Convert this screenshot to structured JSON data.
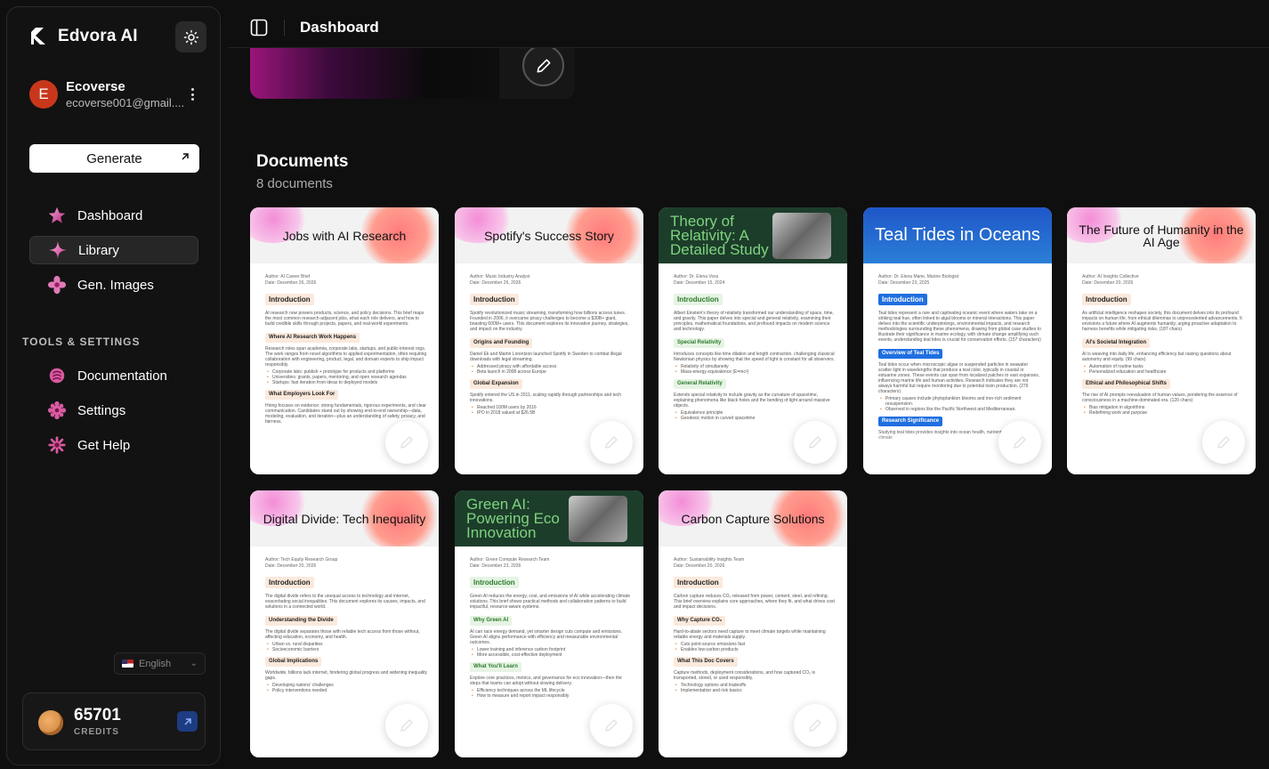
{
  "app": {
    "name": "Edvora AI"
  },
  "user": {
    "initial": "E",
    "name": "Ecoverse",
    "email": "ecoverse001@gmail...."
  },
  "sidebar": {
    "generate_label": "Generate",
    "items": [
      {
        "label": "Dashboard",
        "icon": "star-gem-icon"
      },
      {
        "label": "Library",
        "icon": "sparkle-icon",
        "active": true
      },
      {
        "label": "Gen. Images",
        "icon": "flower-icon"
      }
    ],
    "tools_title": "TOOLS & SETTINGS",
    "tools": [
      {
        "label": "Documentation",
        "icon": "documentation-icon"
      },
      {
        "label": "Settings",
        "icon": "settings-icon"
      },
      {
        "label": "Get Help",
        "icon": "help-icon"
      }
    ],
    "language": "English",
    "credits_value": "65701",
    "credits_label": "CREDITS"
  },
  "header": {
    "title": "Dashboard"
  },
  "documents": {
    "title": "Documents",
    "count": "8 documents",
    "cards": [
      {
        "title": "Jobs with AI Research",
        "style": "gradient",
        "author": "Author: AI Career Brief",
        "date": "Date: December 26, 2026",
        "sections": [
          {
            "heading": "Introduction",
            "size": "lg",
            "lines": [
              "AI research now powers products, science, and policy decisions. This brief maps the most common research-adjacent jobs, what each role delivers, and how to build credible skills through projects, papers, and real-world experiments."
            ]
          },
          {
            "heading": "Where AI Research Work Happens",
            "size": "sm",
            "lines": [
              "Research roles span academia, corporate labs, startups, and public-interest orgs. The work ranges from novel algorithms to applied experimentation, often requiring collaboration with engineering, product, legal, and domain experts to ship impact responsibly."
            ],
            "bullets": [
              "Corporate labs: publish + prototype for products and platforms",
              "Universities: grants, papers, mentoring, and open research agendas",
              "Startups: fast iteration from ideas to deployed models"
            ]
          },
          {
            "heading": "What Employers Look For",
            "size": "sm",
            "lines": [
              "Hiring focuses on evidence: strong fundamentals, rigorous experiments, and clear communication. Candidates stand out by showing end-to-end ownership—data, modeling, evaluation, and iteration—plus an understanding of safety, privacy, and fairness."
            ]
          }
        ]
      },
      {
        "title": "Spotify's Success Story",
        "style": "gradient",
        "author": "Author: Music Industry Analyst",
        "date": "Date: December 26, 2026",
        "sections": [
          {
            "heading": "Introduction",
            "size": "lg",
            "lines": [
              "Spotify revolutionized music streaming, transforming how billions access tunes. Founded in 2006, it overcame piracy challenges to become a $30B+ giant, boasting 600M+ users. This document explores its innovative journey, strategies, and impact on the industry."
            ]
          },
          {
            "heading": "Origins and Founding",
            "size": "sm",
            "lines": [
              "Daniel Ek and Martin Lorentzon launched Spotify in Sweden to combat illegal downloads with legal streaming."
            ],
            "bullets": [
              "Addressed piracy with affordable access",
              "Beta launch in 2008 across Europe"
            ]
          },
          {
            "heading": "Global Expansion",
            "size": "sm",
            "lines": [
              "Spotify entered the US in 2011, scaling rapidly through partnerships and tech innovations."
            ],
            "bullets": [
              "Reached 100M users by 2016",
              "IPO in 2018 valued at $26.5B"
            ]
          }
        ]
      },
      {
        "title": "Theory of Relativity: A Detailed Study",
        "style": "green",
        "author": "Author: Dr. Elena Voss",
        "date": "Date: December 15, 2024",
        "sections": [
          {
            "heading": "Introduction",
            "size": "lg",
            "accent": "green",
            "lines": [
              "Albert Einstein's theory of relativity transformed our understanding of space, time, and gravity. This paper delves into special and general relativity, examining their principles, mathematical foundations, and profound impacts on modern science and technology."
            ]
          },
          {
            "heading": "Special Relativity",
            "size": "sm",
            "accent": "green",
            "lines": [
              "Introduces concepts like time dilation and length contraction, challenging classical Newtonian physics by showing that the speed of light is constant for all observers."
            ],
            "bullets": [
              "Relativity of simultaneity",
              "Mass-energy equivalence (E=mc²)"
            ]
          },
          {
            "heading": "General Relativity",
            "size": "sm",
            "accent": "green",
            "lines": [
              "Extends special relativity to include gravity as the curvature of spacetime, explaining phenomena like black holes and the bending of light around massive objects."
            ],
            "bullets": [
              "Equivalence principle",
              "Geodesic motion in curved spacetime"
            ]
          }
        ]
      },
      {
        "title": "Teal Tides in Oceans",
        "style": "blue",
        "author": "Author: Dr. Elena Marie, Marine Biologist",
        "date": "Date: December 23, 2025",
        "sections": [
          {
            "heading": "Introduction",
            "size": "lg",
            "accent": "blue",
            "lines": [
              "Teal tides represent a rare and captivating oceanic event where waters take on a striking teal hue, often linked to algal blooms or mineral interactions. This paper delves into the scientific underpinnings, environmental impacts, and research methodologies surrounding these phenomena, drawing from global case studies to illustrate their significance in marine ecology, with climate change amplifying such events, understanding teal tides is crucial for conservation efforts. (157 characters)"
            ]
          },
          {
            "heading": "Overview of Teal Tides",
            "size": "sm",
            "accent": "blue",
            "lines": [
              "Teal tides occur when microscopic algae or suspended particles in seawater scatter light in wavelengths that produce a teal color, typically in coastal or estuarine zones. These events can span from localized patches to vast expanses, influencing marine life and human activities. Research indicates they are not always harmful but require monitoring due to potential toxin production. (279 characters)"
            ],
            "bullets": [
              "Primary causes include phytoplankton blooms and iron-rich sediment resuspension.",
              "Observed in regions like the Pacific Northwest and Mediterranean."
            ]
          },
          {
            "heading": "Research Significance",
            "size": "sm",
            "accent": "blue",
            "lines": [
              "Studying teal tides provides insights into ocean health, nutrient cycling, and climate"
            ]
          }
        ]
      },
      {
        "title": "The Future of Humanity in the AI Age",
        "style": "gradient",
        "author": "Author: AI Insights Collective",
        "date": "Date: December 20, 2026",
        "sections": [
          {
            "heading": "Introduction",
            "size": "lg",
            "lines": [
              "As artificial intelligence reshapes society, this document delves into its profound impacts on human life, from ethical dilemmas to unprecedented advancements. It envisions a future where AI augments humanity, urging proactive adaptation to harness benefits while mitigating risks. (187 chars)"
            ]
          },
          {
            "heading": "AI's Societal Integration",
            "size": "sm",
            "lines": [
              "AI is weaving into daily life, enhancing efficiency but raising questions about autonomy and equity. (99 chars)"
            ],
            "bullets": [
              "Automation of routine tasks",
              "Personalized education and healthcare"
            ]
          },
          {
            "heading": "Ethical and Philosophical Shifts",
            "size": "sm",
            "lines": [
              "The rise of AI prompts reevaluation of human values, pondering the essence of consciousness in a machine-dominated era. (120 chars)"
            ],
            "bullets": [
              "Bias mitigation in algorithms",
              "Redefining work and purpose"
            ]
          }
        ]
      },
      {
        "title": "Digital Divide: Tech Inequality",
        "style": "gradient",
        "author": "Author: Tech Equity Research Group",
        "date": "Date: December 20, 2026",
        "sections": [
          {
            "heading": "Introduction",
            "size": "lg",
            "lines": [
              "The digital divide refers to the unequal access to technology and internet, exacerbating social inequalities. This document explores its causes, impacts, and solutions in a connected world."
            ]
          },
          {
            "heading": "Understanding the Divide",
            "size": "sm",
            "lines": [
              "The digital divide separates those with reliable tech access from those without, affecting education, economy, and health."
            ],
            "bullets": [
              "Urban vs. rural disparities",
              "Socioeconomic barriers"
            ]
          },
          {
            "heading": "Global Implications",
            "size": "sm",
            "lines": [
              "Worldwide, billions lack internet, hindering global progress and widening inequality gaps."
            ],
            "bullets": [
              "Developing nations' challenges",
              "Policy interventions needed"
            ]
          }
        ]
      },
      {
        "title": "Green AI: Powering Eco Innovation",
        "style": "green",
        "author": "Author: Green Compute Research Team",
        "date": "Date: December 23, 2026",
        "sections": [
          {
            "heading": "Introduction",
            "size": "lg",
            "accent": "green",
            "lines": [
              "Green AI reduces the energy, cost, and emissions of AI while accelerating climate solutions. This brief shows practical methods and collaboration patterns to build impactful, resource-aware systems."
            ]
          },
          {
            "heading": "Why Green AI",
            "size": "sm",
            "accent": "green",
            "lines": [
              "AI can race energy demand, yet smarter design cuts compute and emissions. Green AI aligns performance with efficiency and measurable environmental outcomes."
            ],
            "bullets": [
              "Lower training and inference carbon footprint",
              "More accessible, cost-effective deployment"
            ]
          },
          {
            "heading": "What You'll Learn",
            "size": "sm",
            "accent": "green",
            "lines": [
              "Explore core practices, metrics, and governance for eco innovation—then the steps that teams can adopt without slowing delivery."
            ],
            "bullets": [
              "Efficiency techniques across the ML lifecycle",
              "How to measure and report impact responsibly"
            ]
          }
        ]
      },
      {
        "title": "Carbon Capture Solutions",
        "style": "gradient",
        "author": "Author: Sustainability Insights Team",
        "date": "Date: December 20, 2026",
        "sections": [
          {
            "heading": "Introduction",
            "size": "lg",
            "lines": [
              "Carbon capture reduces CO₂ released from power, cement, steel, and refining. This brief overview explains core approaches, where they fit, and what drives cost and impact decisions."
            ]
          },
          {
            "heading": "Why Capture CO₂",
            "size": "sm",
            "lines": [
              "Hard-to-abate sectors need capture to meet climate targets while maintaining reliable energy and materials supply."
            ],
            "bullets": [
              "Cuts point-source emissions fast",
              "Enables low-carbon products"
            ]
          },
          {
            "heading": "What This Doc Covers",
            "size": "sm",
            "lines": [
              "Capture methods, deployment considerations, and how captured CO₂ is transported, stored, or used responsibly."
            ],
            "bullets": [
              "Technology options and tradeoffs",
              "Implementation and risk basics"
            ]
          }
        ]
      }
    ]
  },
  "colors": {
    "accent_blue": "#1d3c82",
    "avatar": "#c8371b",
    "green_banner": "#1d3d2b",
    "green_text": "#7ed37e"
  }
}
